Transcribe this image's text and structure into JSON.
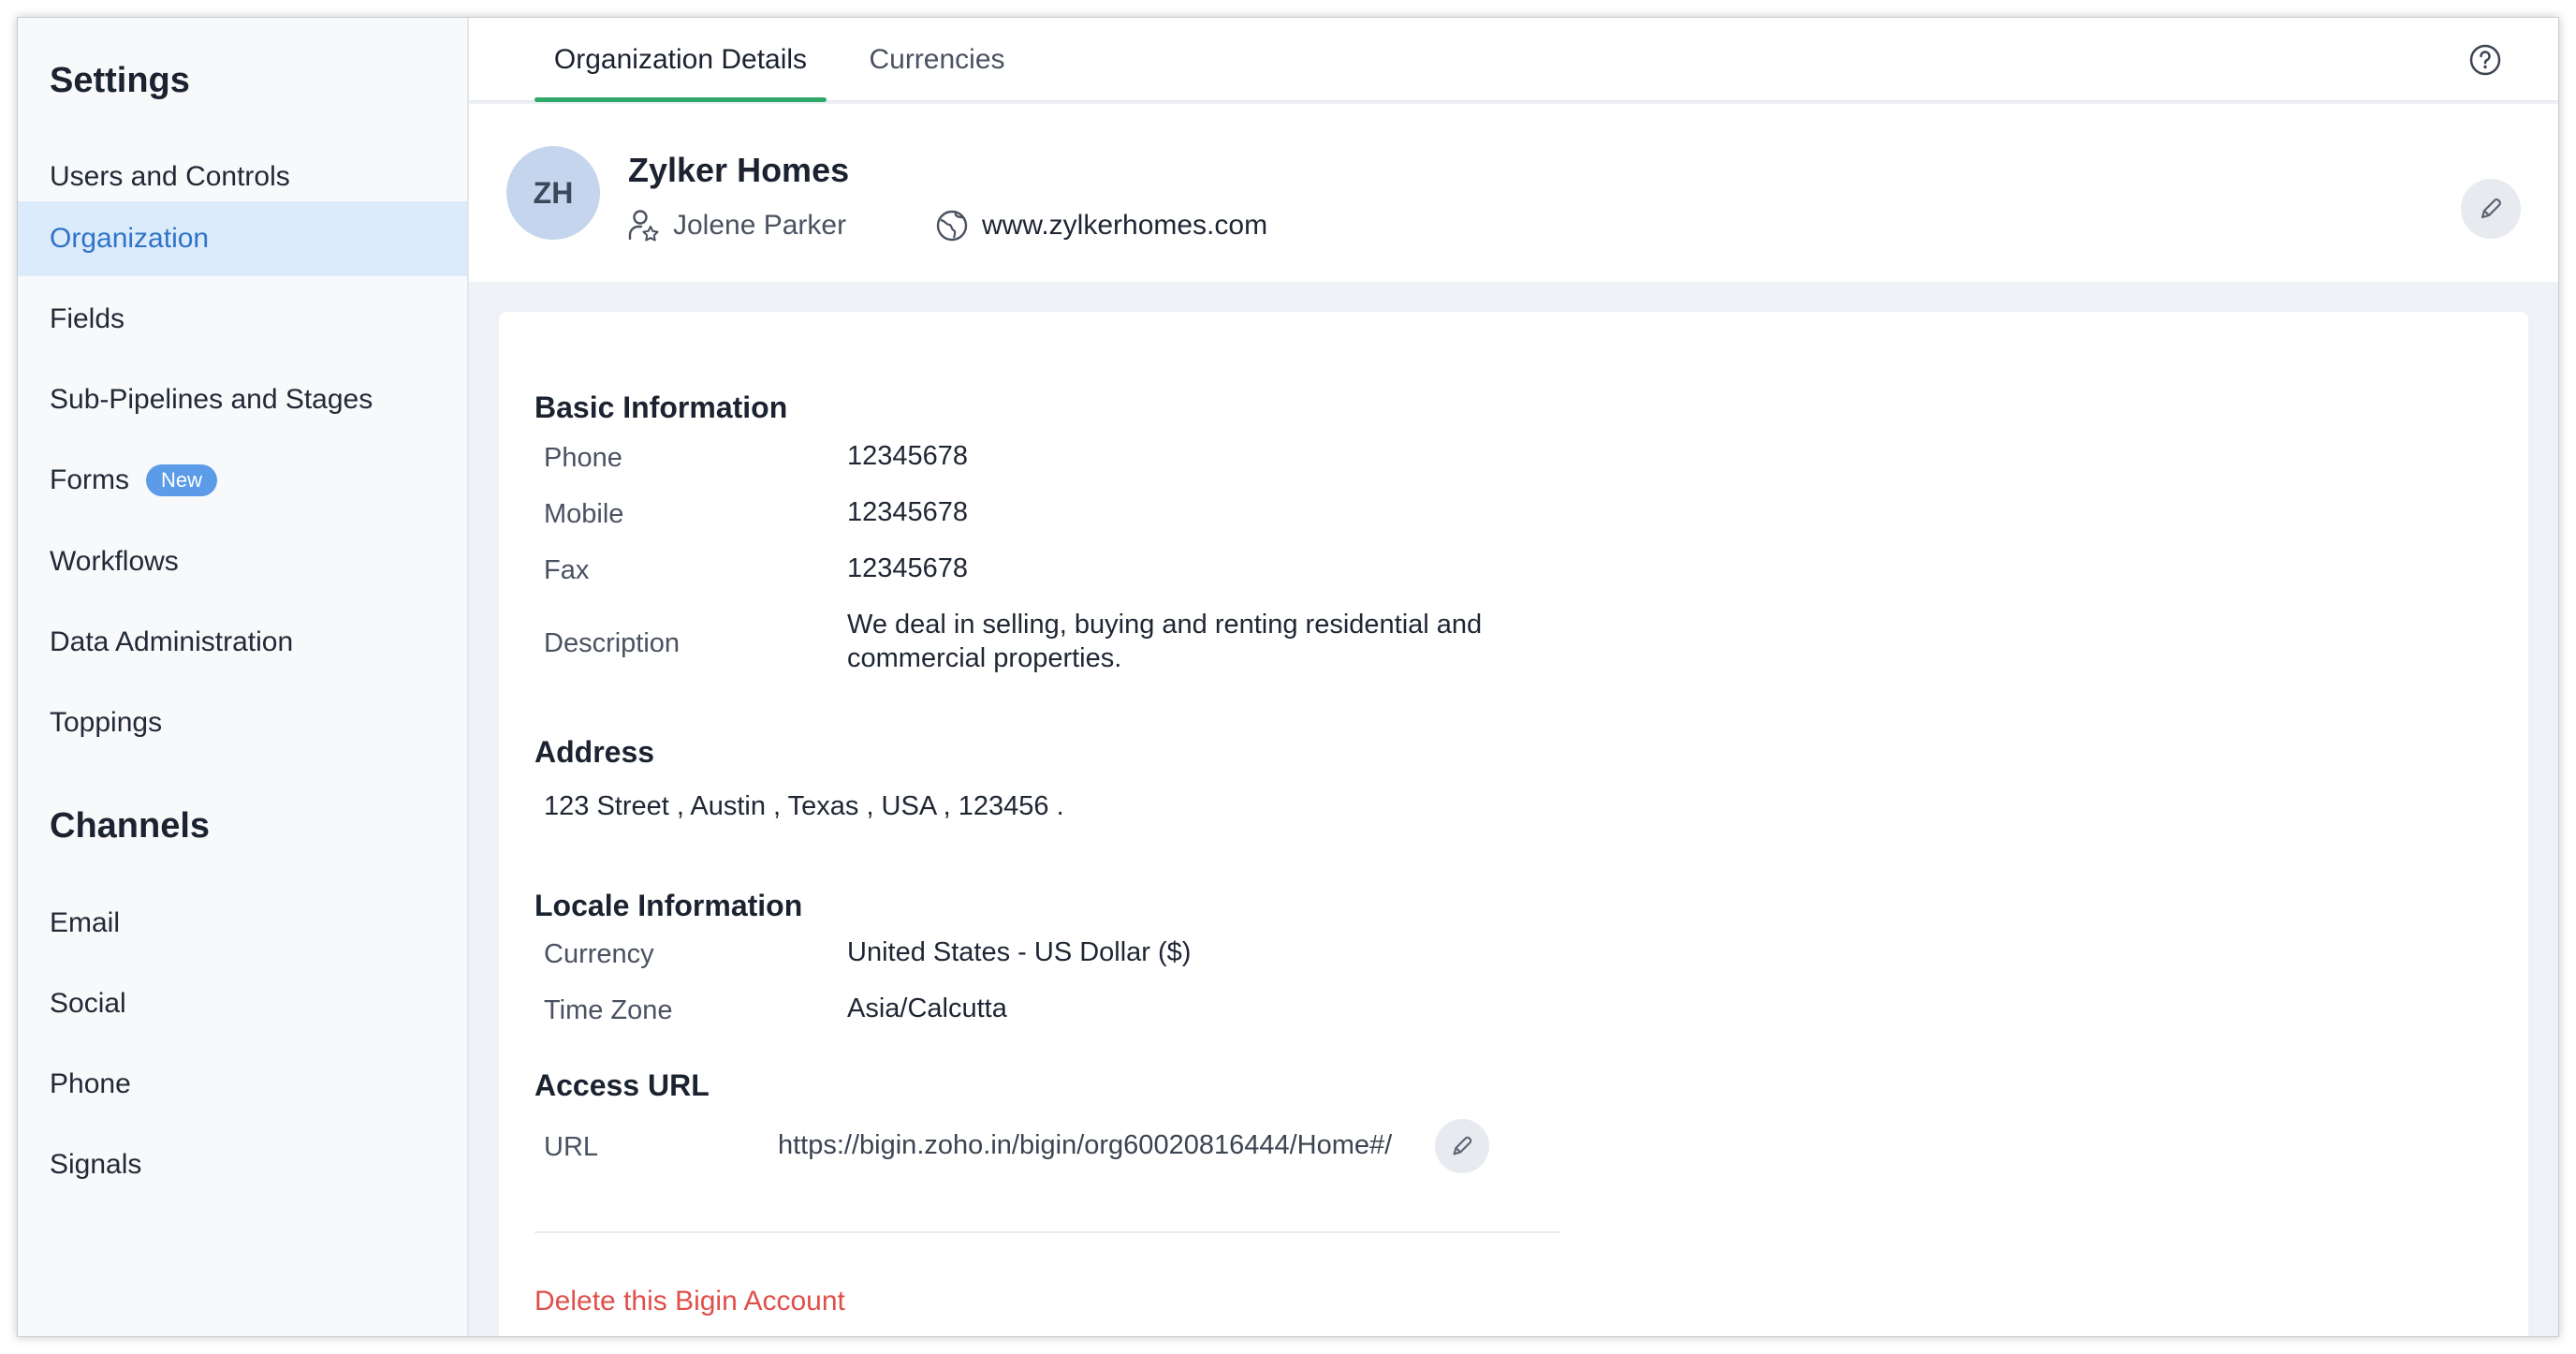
{
  "sidebar": {
    "settings_heading": "Settings",
    "settings_items": [
      {
        "label": "Users and Controls"
      },
      {
        "label": "Organization"
      },
      {
        "label": "Fields"
      },
      {
        "label": "Sub-Pipelines and Stages"
      },
      {
        "label": "Forms",
        "badge": "New"
      },
      {
        "label": "Workflows"
      },
      {
        "label": "Data Administration"
      },
      {
        "label": "Toppings"
      }
    ],
    "channels_heading": "Channels",
    "channel_items": [
      {
        "label": "Email"
      },
      {
        "label": "Social"
      },
      {
        "label": "Phone"
      },
      {
        "label": "Signals"
      }
    ],
    "active_item": "Organization"
  },
  "tabs": [
    {
      "label": "Organization Details"
    },
    {
      "label": "Currencies"
    }
  ],
  "active_tab": "Organization Details",
  "org": {
    "initials": "ZH",
    "name": "Zylker Homes",
    "owner": "Jolene Parker",
    "website": "www.zylkerhomes.com"
  },
  "basic": {
    "title": "Basic Information",
    "phone_label": "Phone",
    "phone_value": "12345678",
    "mobile_label": "Mobile",
    "mobile_value": "12345678",
    "fax_label": "Fax",
    "fax_value": "12345678",
    "description_label": "Description",
    "description_line1": "We deal in selling, buying and renting residential and",
    "description_line2": "commercial properties."
  },
  "address": {
    "title": "Address",
    "value": "123 Street , Austin , Texas , USA , 123456 ."
  },
  "locale": {
    "title": "Locale Information",
    "currency_label": "Currency",
    "currency_value": "United States - US Dollar ($)",
    "timezone_label": "Time Zone",
    "timezone_value": "Asia/Calcutta"
  },
  "access": {
    "title": "Access URL",
    "url_label": "URL",
    "url_value": "https://bigin.zoho.in/bigin/org60020816444/Home#/"
  },
  "delete_label": "Delete this Bigin Account",
  "colors": {
    "accent": "#2f74c8",
    "active_bg": "#dcebfb",
    "tab_underline": "#2fa86a",
    "danger": "#e0504a",
    "badge": "#5b9be8"
  }
}
